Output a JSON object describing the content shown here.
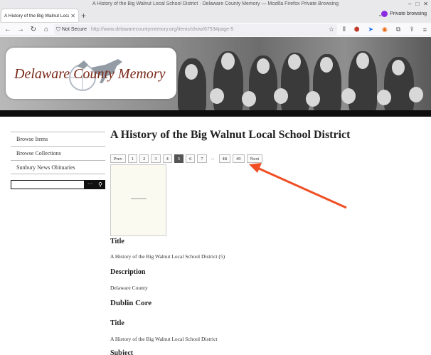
{
  "window": {
    "title": "A History of the Big Walnut Local School District · Delaware County Memory — Mozilla Firefox Private Browsing"
  },
  "tab": {
    "title": "A History of the Big Walnut Local S"
  },
  "browser": {
    "private_label": "Private browsing",
    "not_secure": "Not Secure",
    "url": "http://www.delawarecountymemory.org/items/show/6753#page-5"
  },
  "site": {
    "logo_text": "Delaware County Memory"
  },
  "sidebar": {
    "items": [
      {
        "label": "Browse Items"
      },
      {
        "label": "Browse Collections"
      },
      {
        "label": "Sunbury News Obituaries"
      }
    ],
    "search_value": "",
    "search_more": "···"
  },
  "main": {
    "title": "A History of the Big Walnut Local School District",
    "pager": {
      "prev": "Prev",
      "pages": [
        "1",
        "2",
        "3",
        "4",
        "5",
        "6",
        "7"
      ],
      "current": "5",
      "ellipsis": "...",
      "tail": [
        "48",
        "49"
      ],
      "next": "Next"
    },
    "sections": [
      {
        "heading": "Title",
        "value": "A History of the Big Walnut Local School District (5)"
      },
      {
        "heading": "Description",
        "value": "Delaware County"
      },
      {
        "heading": "Dublin Core",
        "value": ""
      },
      {
        "heading": "Title",
        "value": "A History of the Big Walnut Local School District"
      },
      {
        "heading": "Subject",
        "value": ""
      }
    ]
  },
  "colors": {
    "logo": "#7a2a1a",
    "arrow": "#f04e23",
    "active_page": "#555555"
  }
}
